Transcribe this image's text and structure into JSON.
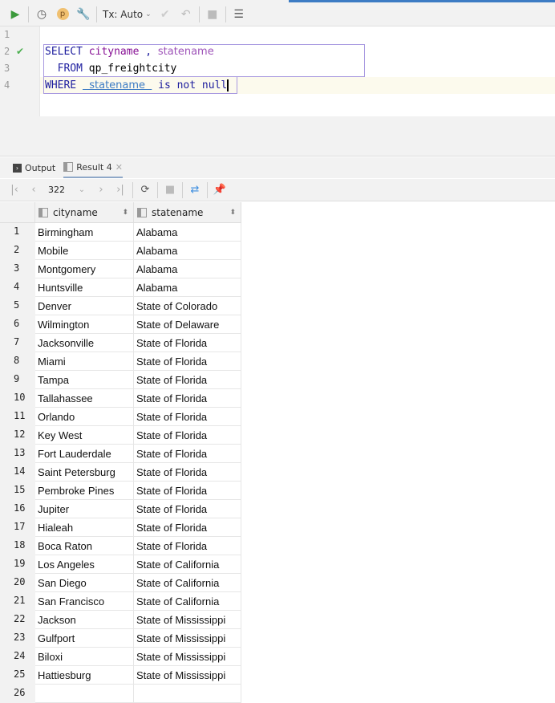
{
  "toolbar": {
    "tx_label": "Tx: Auto"
  },
  "editor": {
    "line_numbers": [
      "1",
      "2",
      "3",
      "4"
    ],
    "line2": {
      "kw": "SELECT",
      "c1": "cityname",
      "comma": " , ",
      "c2": "statename"
    },
    "line3": {
      "kw": "FROM",
      "table": "qp_freightcity"
    },
    "line4": {
      "kw": "WHERE",
      "param": "  statename  ",
      "rest": " is not null"
    }
  },
  "tabs": {
    "output": "Output",
    "result": "Result 4"
  },
  "pager": {
    "rows": "322"
  },
  "grid": {
    "columns": [
      "cityname",
      "statename"
    ],
    "rows": [
      [
        "1",
        "Birmingham",
        "Alabama"
      ],
      [
        "2",
        "Mobile",
        "Alabama"
      ],
      [
        "3",
        "Montgomery",
        "Alabama"
      ],
      [
        "4",
        "Huntsville",
        "Alabama"
      ],
      [
        "5",
        "Denver",
        "State of Colorado"
      ],
      [
        "6",
        "Wilmington",
        "State of Delaware"
      ],
      [
        "7",
        "Jacksonville",
        "State of Florida"
      ],
      [
        "8",
        "Miami",
        "State of Florida"
      ],
      [
        "9",
        "Tampa",
        "State of Florida"
      ],
      [
        "10",
        "Tallahassee",
        "State of Florida"
      ],
      [
        "11",
        "Orlando",
        "State of Florida"
      ],
      [
        "12",
        "Key West",
        "State of Florida"
      ],
      [
        "13",
        "Fort Lauderdale",
        "State of Florida"
      ],
      [
        "14",
        "Saint Petersburg",
        "State of Florida"
      ],
      [
        "15",
        "Pembroke Pines",
        "State of Florida"
      ],
      [
        "16",
        "Jupiter",
        "State of Florida"
      ],
      [
        "17",
        "Hialeah",
        "State of Florida"
      ],
      [
        "18",
        "Boca Raton",
        "State of Florida"
      ],
      [
        "19",
        "Los Angeles",
        "State of California"
      ],
      [
        "20",
        "San Diego",
        "State of California"
      ],
      [
        "21",
        "San Francisco",
        "State of California"
      ],
      [
        "22",
        "Jackson",
        "State of Mississippi"
      ],
      [
        "23",
        "Gulfport",
        "State of Mississippi"
      ],
      [
        "24",
        "Biloxi",
        "State of Mississippi"
      ],
      [
        "25",
        "Hattiesburg",
        "State of Mississippi"
      ],
      [
        "26",
        "",
        ""
      ]
    ]
  }
}
